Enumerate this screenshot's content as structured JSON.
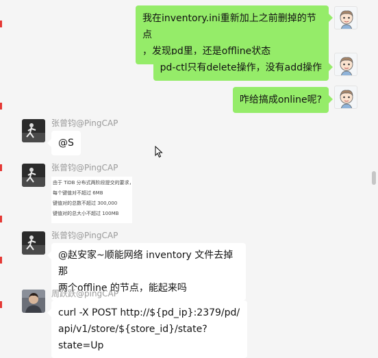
{
  "outgoing": [
    {
      "lines": [
        "我在inventory.ini重新加上之前删掉的节点",
        "，发现pd里，还是offline状态"
      ]
    },
    {
      "lines": [
        "pd-ctl只有delete操作，没有add操作"
      ]
    },
    {
      "lines": [
        "咋给搞成online呢?"
      ]
    }
  ],
  "incoming": [
    {
      "sender": "张曾钧@PingCAP",
      "lines": [
        "@S"
      ]
    },
    {
      "sender": "张曾钧@PingCAP",
      "image_lines": [
        "由于 TiDB 分布式两阶段提交的要求，",
        "每个键值对不超过 6MB",
        "键值对的总数不超过 300,000",
        "键值对的总大小不超过 100MB"
      ]
    },
    {
      "sender": "张曾钧@PingCAP",
      "lines": [
        "@赵安家~顺能网络  inventory 文件去掉那",
        "两个offline 的节点，能起来吗"
      ]
    },
    {
      "sender": "周跃跃@pingCAP",
      "lines": [
        "curl -X POST http://${pd_ip}:2379/pd/",
        "api/v1/store/${store_id}/state?state=Up"
      ]
    }
  ],
  "icons": {
    "self_avatar": "cartoon-boy-avatar",
    "runner_avatar": "runner-photo-avatar",
    "person_avatar": "person-photo-avatar"
  },
  "colors": {
    "outgoing_bubble": "#95ec69",
    "incoming_bubble": "#ffffff",
    "background": "#f5f5f5"
  }
}
